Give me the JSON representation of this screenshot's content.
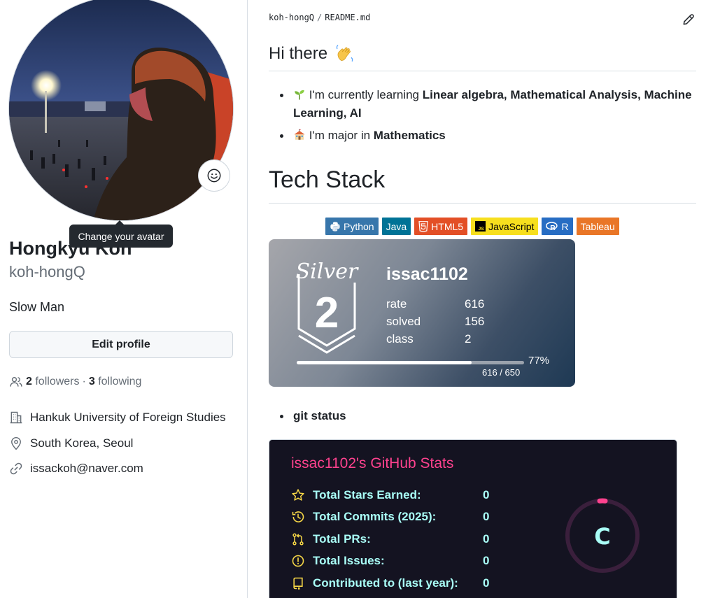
{
  "tooltip": "Change your avatar",
  "profile": {
    "name": "Hongkyu Koh",
    "login": "koh-hongQ",
    "bio": "Slow Man",
    "edit_label": "Edit profile",
    "followers_count": "2",
    "followers_label": "followers",
    "dot": "·",
    "following_count": "3",
    "following_label": "following",
    "organization": "Hankuk University of Foreign Studies",
    "location": "South Korea, Seoul",
    "email": "issackoh@naver.com"
  },
  "readme": {
    "path_user": "koh-hongQ",
    "path_sep": "/",
    "path_file": "README.md",
    "heading_hi": "Hi there",
    "bullet1_prefix": "I'm currently learning ",
    "bullet1_bold": "Linear algebra, Mathematical Analysis, Machine Learning, AI",
    "bullet2_prefix": "I'm major in ",
    "bullet2_bold": "Mathematics",
    "heading_tech": "Tech Stack",
    "badges": [
      {
        "label": "Python",
        "color": "#3776ab"
      },
      {
        "label": "Java",
        "color": "#007396"
      },
      {
        "label": "HTML5",
        "color": "#e34f26"
      },
      {
        "label": "JavaScript",
        "color": "#f7df1e"
      },
      {
        "label": "R",
        "color": "#276dc3"
      },
      {
        "label": "Tableau",
        "color": "#e97627"
      }
    ],
    "git_status": "git status"
  },
  "solved": {
    "tier_name": "Silver",
    "tier_level": "2",
    "handle": "issac1102",
    "rate_label": "rate",
    "rate_value": "616",
    "solved_label": "solved",
    "solved_value": "156",
    "class_label": "class",
    "class_value": "2",
    "progress_fraction": 0.77,
    "progress_pct": "77%",
    "progress_text": "616 / 650"
  },
  "github_stats": {
    "title": "issac1102's GitHub Stats",
    "rows": [
      {
        "label": "Total Stars Earned:",
        "value": "0",
        "icon": "star-icon"
      },
      {
        "label": "Total Commits (2025):",
        "value": "0",
        "icon": "history-icon"
      },
      {
        "label": "Total PRs:",
        "value": "0",
        "icon": "pull-request-icon"
      },
      {
        "label": "Total Issues:",
        "value": "0",
        "icon": "issue-icon"
      },
      {
        "label": "Contributed to (last year):",
        "value": "0",
        "icon": "repo-icon"
      }
    ],
    "rank": "C",
    "colors": {
      "title": "#fe428e",
      "text": "#a9fef7",
      "icon": "#f8d847",
      "bg": "#141321"
    }
  }
}
